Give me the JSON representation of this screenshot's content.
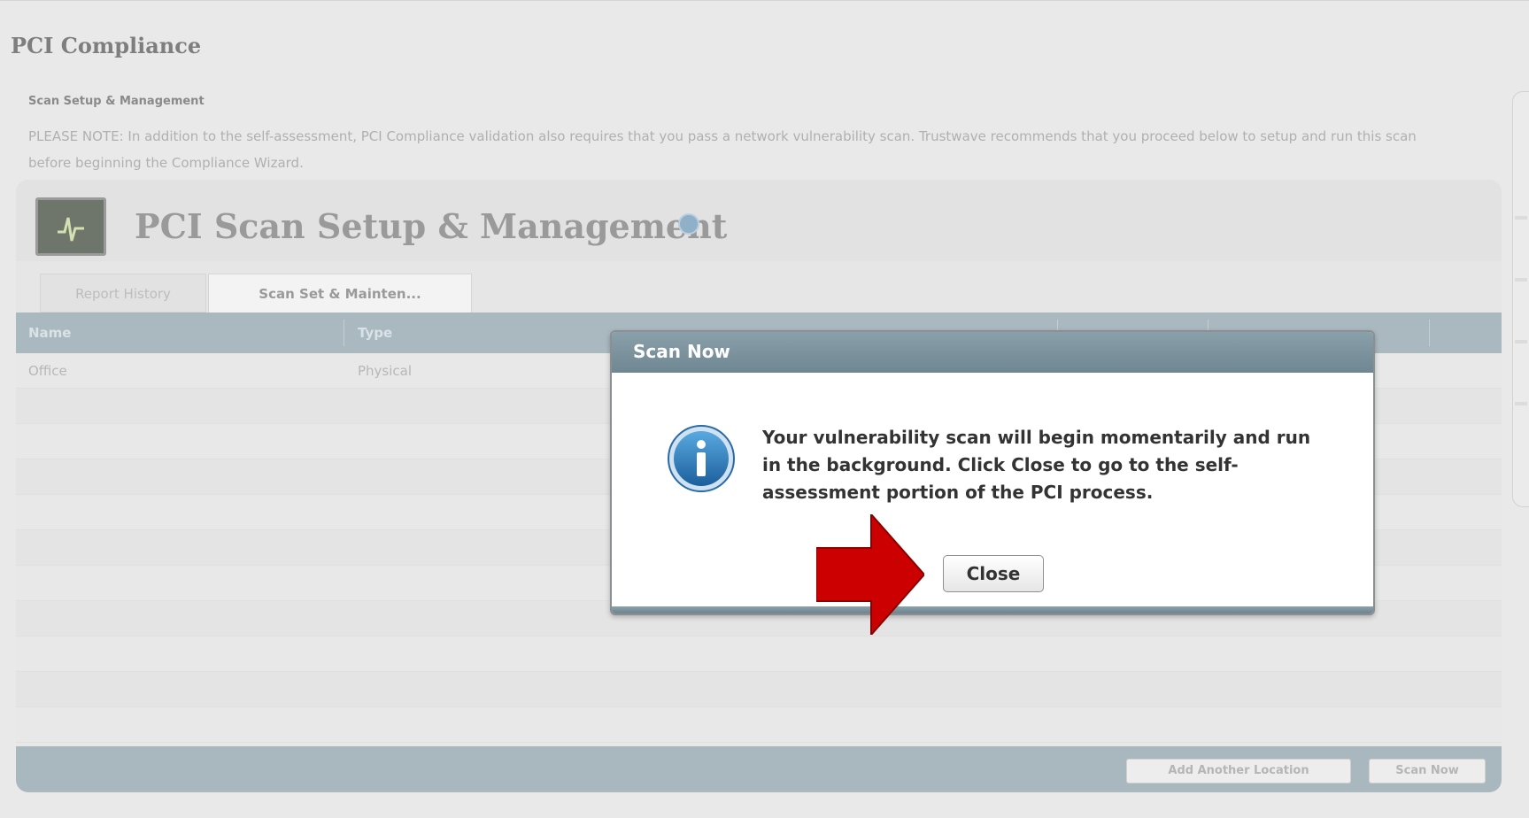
{
  "page": {
    "title": "PCI Compliance",
    "section_label": "Scan Setup & Management",
    "note": "PLEASE NOTE: In addition to the self-assessment, PCI Compliance validation also requires that you pass a network vulnerability scan. Trustwave recommends that you proceed below to setup and run this scan before beginning the Compliance Wizard."
  },
  "widget": {
    "title": "PCI Scan Setup & Management",
    "icon": "heartbeat-monitor-icon",
    "help_icon": "help-question-icon",
    "tabs": [
      {
        "label": "Report History",
        "active": false
      },
      {
        "label": "Scan Set & Mainten...",
        "active": true
      }
    ],
    "grid": {
      "columns": [
        "Name",
        "Type"
      ],
      "rows": [
        {
          "name": "Office",
          "type": "Physical"
        }
      ]
    },
    "footer_buttons": {
      "add_location": "Add Another Location",
      "scan_now": "Scan Now"
    }
  },
  "dialog": {
    "title": "Scan Now",
    "icon": "info-icon",
    "message": "Your vulnerability scan will begin momentarily and run in the background. Click Close to go to the self-assessment portion of the PCI process.",
    "close_label": "Close"
  },
  "annotation": {
    "icon": "red-arrow-icon",
    "color": "#cc0000"
  },
  "colors": {
    "dialog_titlebar": "#7a919c",
    "grid_header": "#aab9c0",
    "arrow_red": "#cc0000"
  }
}
